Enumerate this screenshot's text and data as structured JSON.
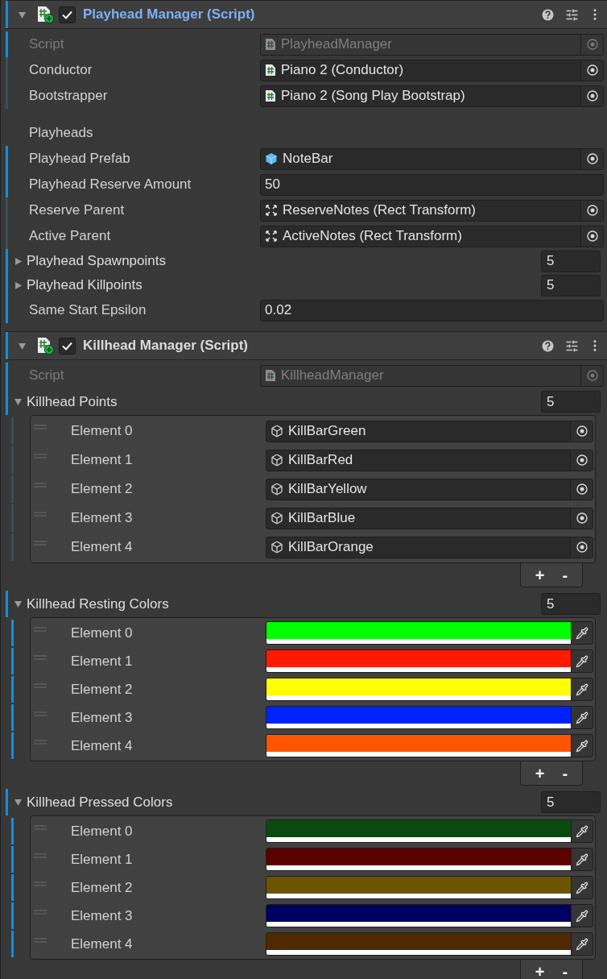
{
  "components": [
    {
      "title": "Playhead Manager (Script)",
      "enabled": true,
      "expanded": true,
      "selected": true,
      "modified": true,
      "rows": [
        {
          "kind": "script_ref",
          "label": "Script",
          "value": "PlayheadManager",
          "disabled": true,
          "modified": true
        },
        {
          "kind": "script_ref",
          "label": "Conductor",
          "value": "Piano 2 (Conductor)",
          "disabled": false,
          "modified": false
        },
        {
          "kind": "script_ref",
          "label": "Bootstrapper",
          "value": "Piano 2 (Song Play Bootstrap)",
          "disabled": false,
          "modified": false
        },
        {
          "kind": "header",
          "label": "Playheads"
        },
        {
          "kind": "prefab_ref",
          "label": "Playhead Prefab",
          "value": "NoteBar",
          "disabled": false,
          "modified": true
        },
        {
          "kind": "text",
          "label": "Playhead Reserve Amount",
          "value": "50",
          "modified": true
        },
        {
          "kind": "rect_ref",
          "label": "Reserve Parent",
          "value": "ReserveNotes (Rect Transform)",
          "disabled": false,
          "modified": false
        },
        {
          "kind": "rect_ref",
          "label": "Active Parent",
          "value": "ActiveNotes (Rect Transform)",
          "disabled": false,
          "modified": false
        },
        {
          "kind": "list",
          "label": "Playhead Spawnpoints",
          "count": "5",
          "expanded": false,
          "modified": true
        },
        {
          "kind": "list",
          "label": "Playhead Killpoints",
          "count": "5",
          "expanded": false,
          "modified": true
        },
        {
          "kind": "text",
          "label": "Same Start Epsilon",
          "value": "0.02",
          "modified": true
        }
      ]
    },
    {
      "title": "Killhead Manager (Script)",
      "enabled": true,
      "expanded": true,
      "selected": false,
      "modified": true,
      "rows": [
        {
          "kind": "script_ref",
          "label": "Script",
          "value": "KillheadManager",
          "disabled": true,
          "modified": true
        },
        {
          "kind": "list",
          "label": "Killhead Points",
          "count": "5",
          "expanded": true,
          "modified": true,
          "items": [
            {
              "kind": "object_ref",
              "label": "Element 0",
              "value": "KillBarGreen",
              "modified": false
            },
            {
              "kind": "object_ref",
              "label": "Element 1",
              "value": "KillBarRed",
              "modified": false
            },
            {
              "kind": "object_ref",
              "label": "Element 2",
              "value": "KillBarYellow",
              "modified": false
            },
            {
              "kind": "object_ref",
              "label": "Element 3",
              "value": "KillBarBlue",
              "modified": false
            },
            {
              "kind": "object_ref",
              "label": "Element 4",
              "value": "KillBarOrange",
              "modified": false
            }
          ],
          "buttons": [
            "+",
            "-"
          ]
        },
        {
          "kind": "list",
          "label": "Killhead Resting Colors",
          "count": "5",
          "expanded": true,
          "modified": true,
          "items": [
            {
              "kind": "color",
              "label": "Element 0",
              "color": "#00ff00",
              "modified": true
            },
            {
              "kind": "color",
              "label": "Element 1",
              "color": "#ff1a00",
              "modified": true
            },
            {
              "kind": "color",
              "label": "Element 2",
              "color": "#ffff00",
              "modified": true
            },
            {
              "kind": "color",
              "label": "Element 3",
              "color": "#0022ff",
              "modified": true
            },
            {
              "kind": "color",
              "label": "Element 4",
              "color": "#ff5500",
              "modified": true
            }
          ],
          "buttons": [
            "+",
            "-"
          ]
        },
        {
          "kind": "list",
          "label": "Killhead Pressed Colors",
          "count": "5",
          "expanded": true,
          "modified": true,
          "items": [
            {
              "kind": "color",
              "label": "Element 0",
              "color": "#0a4a10",
              "modified": true
            },
            {
              "kind": "color",
              "label": "Element 1",
              "color": "#5c0000",
              "modified": true
            },
            {
              "kind": "color",
              "label": "Element 2",
              "color": "#6b5500",
              "modified": true
            },
            {
              "kind": "color",
              "label": "Element 3",
              "color": "#000060",
              "modified": true
            },
            {
              "kind": "color",
              "label": "Element 4",
              "color": "#4f2a00",
              "modified": true
            }
          ],
          "buttons": [
            "+",
            "-"
          ]
        }
      ]
    }
  ]
}
